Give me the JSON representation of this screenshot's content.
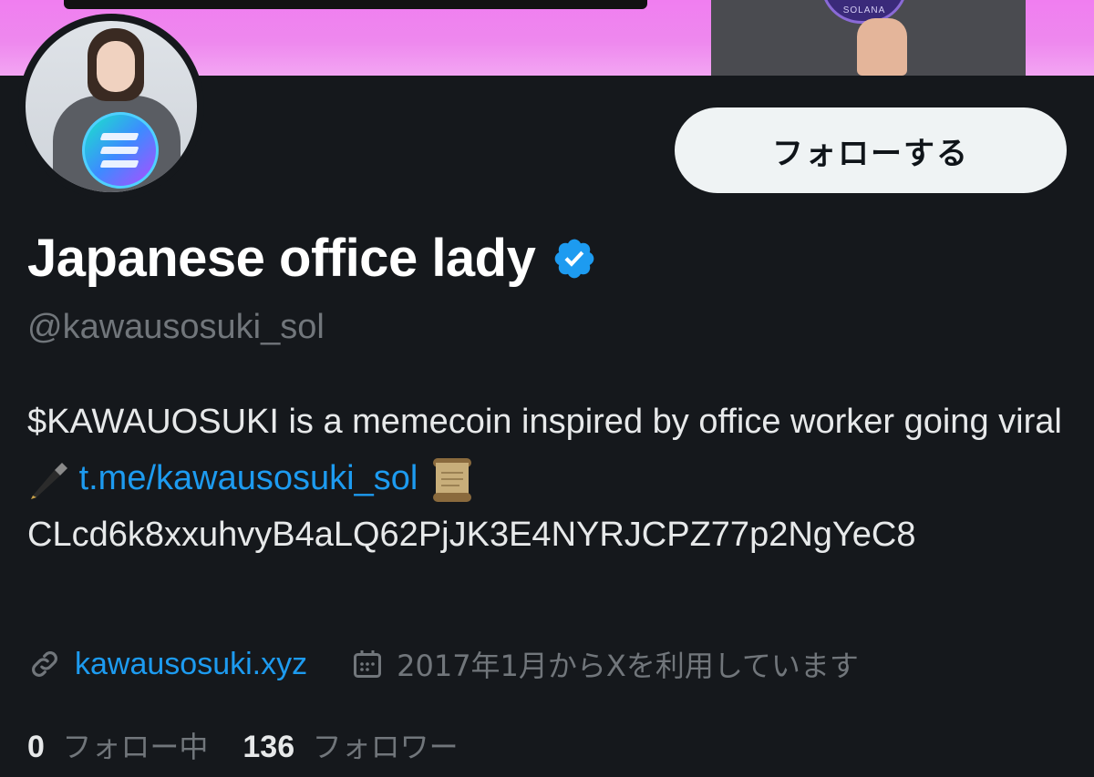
{
  "banner": {
    "coin_text": "SOLANA"
  },
  "profile": {
    "display_name": "Japanese office lady",
    "handle": "@kawausosuki_sol",
    "verified": true,
    "follow_button_label": "フォローする"
  },
  "bio": {
    "text_1": "$KAWAUOSUKI is a memecoin inspired by office worker going viral",
    "emoji_1": "fountain-pen-icon",
    "link": "t.me/kawausosuki_sol",
    "emoji_2": "scroll-icon",
    "text_2": "CLcd6k8xxuhvyB4aLQ62PjJK3E4NYRJCPZ77p2NgYeC8"
  },
  "meta": {
    "website": "kawausosuki.xyz",
    "joined": "2017年1月からXを利用しています"
  },
  "stats": {
    "following_count": "0",
    "following_label": "フォロー中",
    "followers_count": "136",
    "followers_label": "フォロワー"
  },
  "colors": {
    "accent": "#1d9bf0",
    "background": "#15181c",
    "muted": "#71767b",
    "banner": "#ee88ee"
  }
}
